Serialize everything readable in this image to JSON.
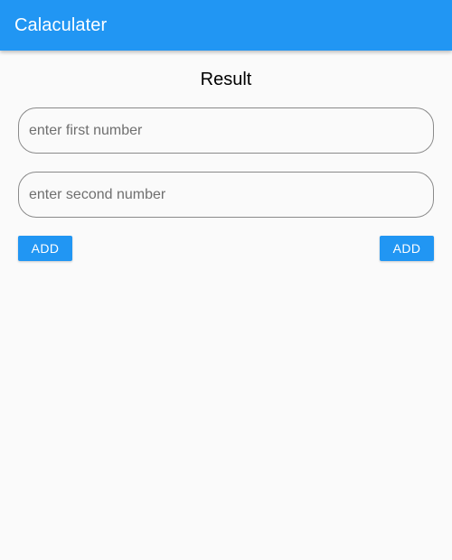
{
  "app_bar": {
    "title": "Calaculater",
    "color": "#2196f3"
  },
  "result": {
    "label": "Result"
  },
  "inputs": {
    "first": {
      "value": "",
      "placeholder": "enter first number"
    },
    "second": {
      "value": "",
      "placeholder": "enter second number"
    }
  },
  "buttons": {
    "left_label": "ADD",
    "right_label": "ADD",
    "color": "#2196f3"
  }
}
